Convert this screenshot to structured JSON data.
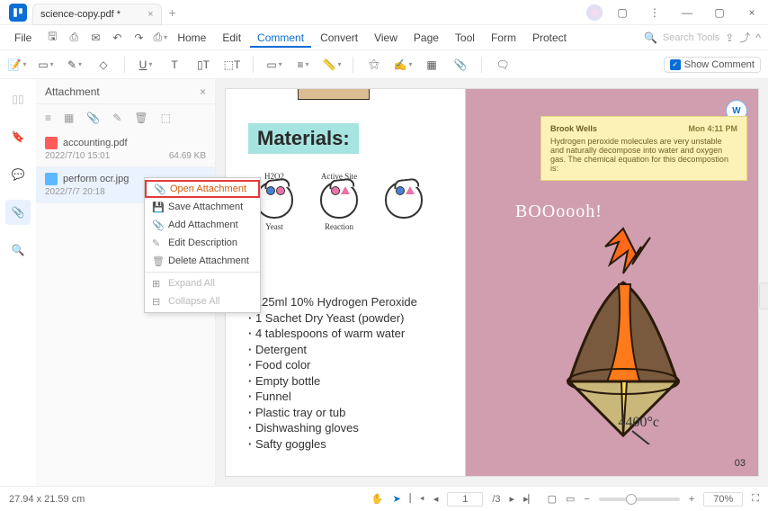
{
  "titlebar": {
    "tab_title": "science-copy.pdf *"
  },
  "menu": {
    "file": "File",
    "items": [
      "Home",
      "Edit",
      "Comment",
      "Convert",
      "View",
      "Page",
      "Tool",
      "Form",
      "Protect"
    ],
    "active": "Comment",
    "search_placeholder": "Search Tools"
  },
  "toolbar": {
    "show_comment": "Show Comment"
  },
  "sidebar": {
    "title": "Attachment",
    "items": [
      {
        "name": "accounting.pdf",
        "date": "2022/7/10 15:01",
        "size": "64.69 KB",
        "type": "pdf"
      },
      {
        "name": "perform ocr.jpg",
        "date": "2022/7/7 20:18",
        "size": "",
        "type": "img"
      }
    ]
  },
  "context_menu": {
    "items": [
      {
        "label": "Open Attachment",
        "highlight": true
      },
      {
        "label": "Save Attachment"
      },
      {
        "label": "Add Attachment"
      },
      {
        "label": "Edit Description"
      },
      {
        "label": "Delete Attachment"
      },
      {
        "sep": true
      },
      {
        "label": "Expand All",
        "disabled": true
      },
      {
        "label": "Collapse All",
        "disabled": true
      }
    ]
  },
  "document": {
    "materials_title": "Materials:",
    "diagram_labels": {
      "h2o2": "H2O2",
      "active_site": "Active Site",
      "yeast": "Yeast",
      "reaction": "Reaction"
    },
    "list": [
      "125ml 10% Hydrogen Peroxide",
      "1 Sachet Dry Yeast (powder)",
      "4 tablespoons of warm water",
      "Detergent",
      "Food color",
      "Empty bottle",
      "Funnel",
      "Plastic tray or tub",
      "Dishwashing gloves",
      "Safty goggles"
    ],
    "note": {
      "author": "Brook Wells",
      "time": "Mon 4:11 PM",
      "body": "Hydrogen peroxide molecules are very unstable and naturally decompose into water and oxygen gas. The chemical equation for this decompostion is:"
    },
    "boom": "BOOoooh!",
    "temp": "4400°c",
    "page_num": "03"
  },
  "statusbar": {
    "dims": "27.94 x 21.59 cm",
    "page_current": "1",
    "page_total": "/3",
    "zoom": "70%"
  }
}
